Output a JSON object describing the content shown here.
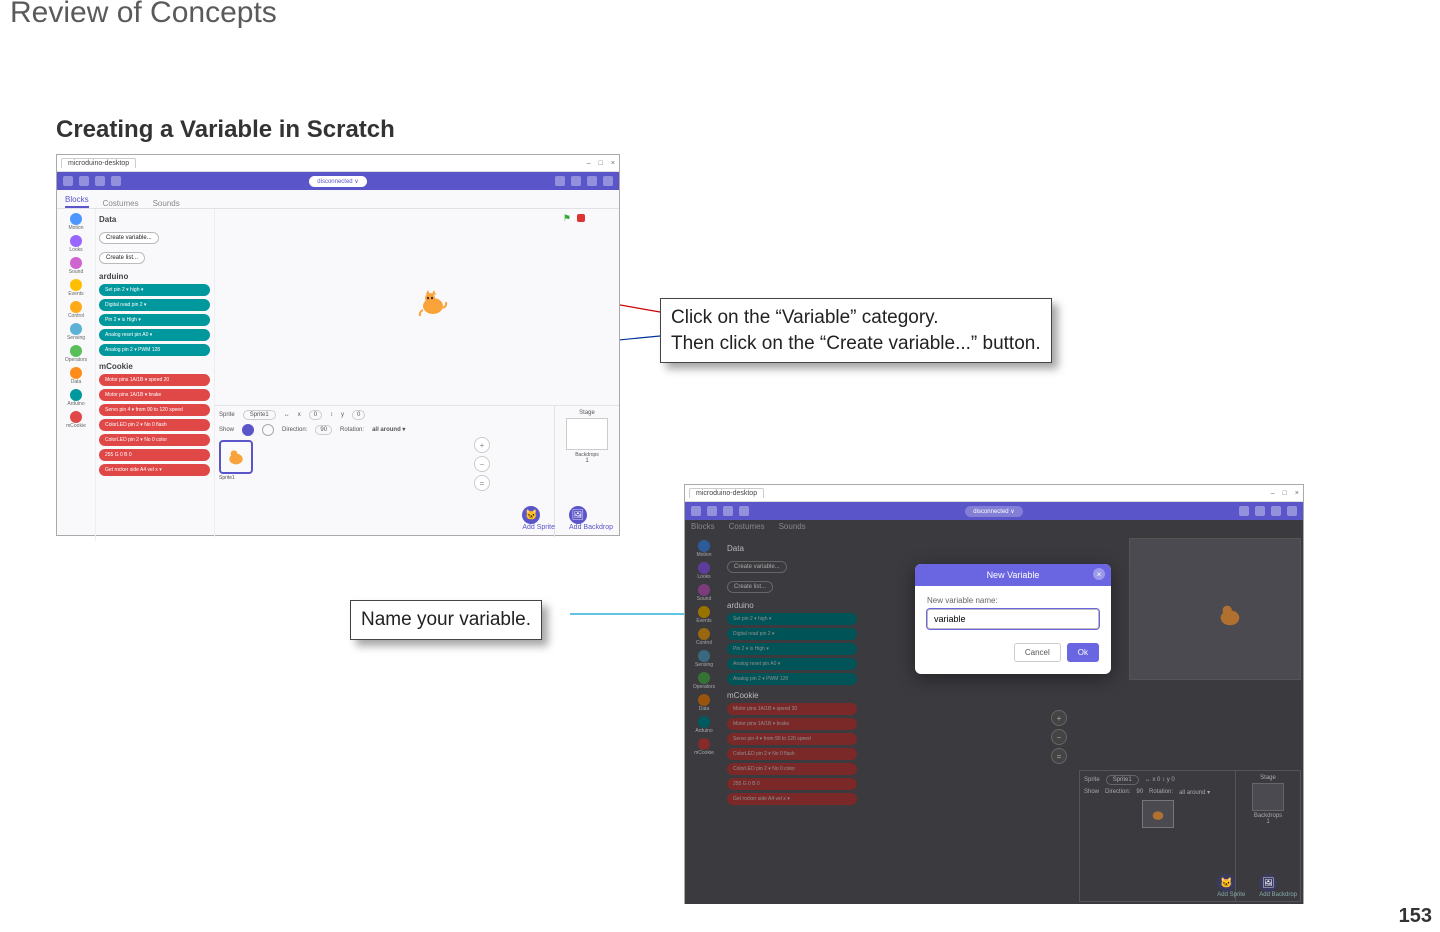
{
  "page": {
    "title": "Review of Concepts",
    "section": "Creating a Variable in Scratch",
    "number": "153"
  },
  "callouts": {
    "c1_line1": "Click on the “Variable” category.",
    "c1_line2": "Then click on the “Create variable...” button.",
    "c2": "Name your variable."
  },
  "common": {
    "windowTitle": "microduino-desktop",
    "winMin": "–",
    "winMax": "□",
    "winClose": "×",
    "disconnected": "disconnected  ∨",
    "tabs": {
      "blocks": "Blocks",
      "costumes": "Costumes",
      "sounds": "Sounds"
    },
    "categories": [
      {
        "name": "Motion",
        "color": "#4C97FF"
      },
      {
        "name": "Looks",
        "color": "#9966FF"
      },
      {
        "name": "Sound",
        "color": "#CF63CF"
      },
      {
        "name": "Events",
        "color": "#FFBF00"
      },
      {
        "name": "Control",
        "color": "#FFAB19"
      },
      {
        "name": "Sensing",
        "color": "#5CB1D6"
      },
      {
        "name": "Operators",
        "color": "#59C059"
      },
      {
        "name": "Data",
        "color": "#FF8C1A"
      },
      {
        "name": "Arduino",
        "color": "#00979D"
      },
      {
        "name": "mCookie",
        "color": "#E04848"
      }
    ],
    "dataHeader": "Data",
    "createVariable": "Create variable...",
    "createList": "Create list...",
    "arduinoHeader": "arduino",
    "arduinoBlocks": [
      "Set pin  2 ▾  high ▾",
      "Digital read pin  2 ▾",
      "Pin  2 ▾  is  High ▾",
      "Analog reset pin  A0 ▾",
      "Analog pin  2 ▾  PWM  128"
    ],
    "mcookieHeader": "mCookie",
    "mcookieBlocks": [
      "Motor pins  1A/1B ▾  speed  20",
      "Motor pins  1A/1B ▾  brake",
      "Servo pin  4 ▾  from  90  to  120  speed",
      "ColorLED pin  2 ▾  No  0  flash  ",
      "ColorLED pin  2 ▾  No  0  color  ",
      "255  G  0  B  0",
      "Get rocker side  A4  vel x ▾"
    ],
    "stage": {
      "spriteLabel": "Sprite",
      "spriteName": "Sprite1",
      "x": "x",
      "xv": "0",
      "y": "y",
      "yv": "0",
      "show": "Show",
      "direction": "Direction:",
      "dv": "90",
      "rotation": "Rotation:",
      "rv": "all around ▾",
      "stageLabel": "Stage",
      "backdrops": "Backdrops",
      "bn": "1",
      "addSprite": "Add Sprite",
      "addBackdrop": "Add Backdrop"
    }
  },
  "modal": {
    "title": "New Variable",
    "label": "New variable name:",
    "value": "variable",
    "cancel": "Cancel",
    "ok": "Ok"
  }
}
